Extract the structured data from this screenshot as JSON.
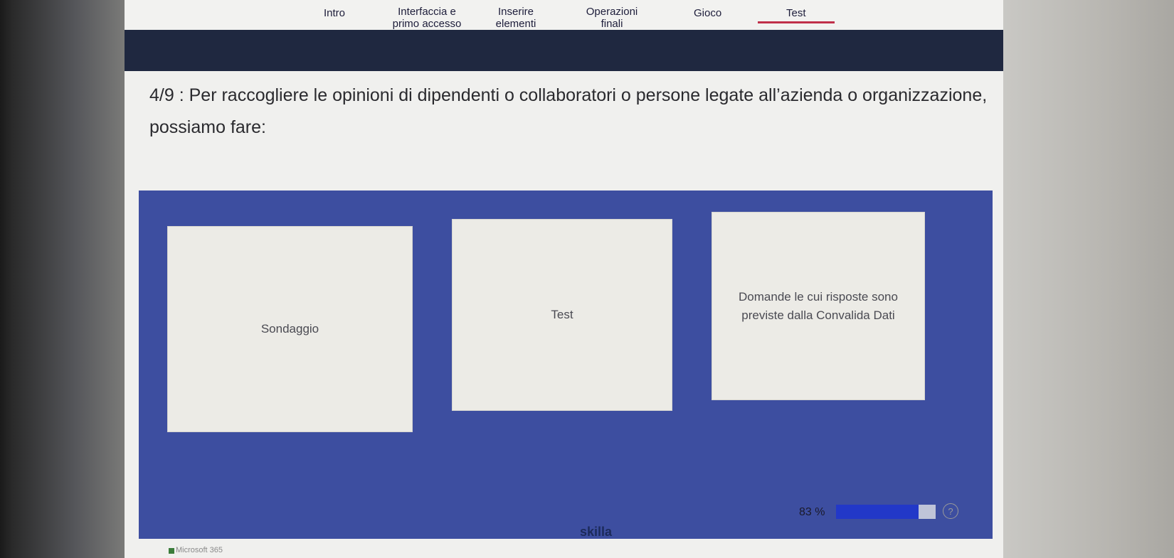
{
  "nav": {
    "items": [
      {
        "label": "Intro"
      },
      {
        "label": "Interfaccia e primo accesso"
      },
      {
        "label": "Inserire elementi"
      },
      {
        "label": "Operazioni finali"
      },
      {
        "label": "Gioco"
      },
      {
        "label": "Test"
      }
    ],
    "active": "Test"
  },
  "question": {
    "number": "4/9",
    "text": "Per raccogliere le opinioni di dipendenti o collaboratori o persone legate all’azienda o organizzazione, possiamo fare:"
  },
  "options": [
    {
      "label": "Sondaggio"
    },
    {
      "label": "Test"
    },
    {
      "label": "Domande le cui risposte sono previste dalla Convalida Dati"
    }
  ],
  "footer": {
    "brand": "skilla",
    "progress_text": "83 %",
    "progress_value": 0.83,
    "help_icon": "question-circle-icon"
  },
  "taskbar": {
    "text": "Microsoft 365"
  },
  "colors": {
    "panel": "#3d4ea0",
    "band": "#1f2840",
    "accent": "#c0304a",
    "progress": "#2238c8"
  }
}
